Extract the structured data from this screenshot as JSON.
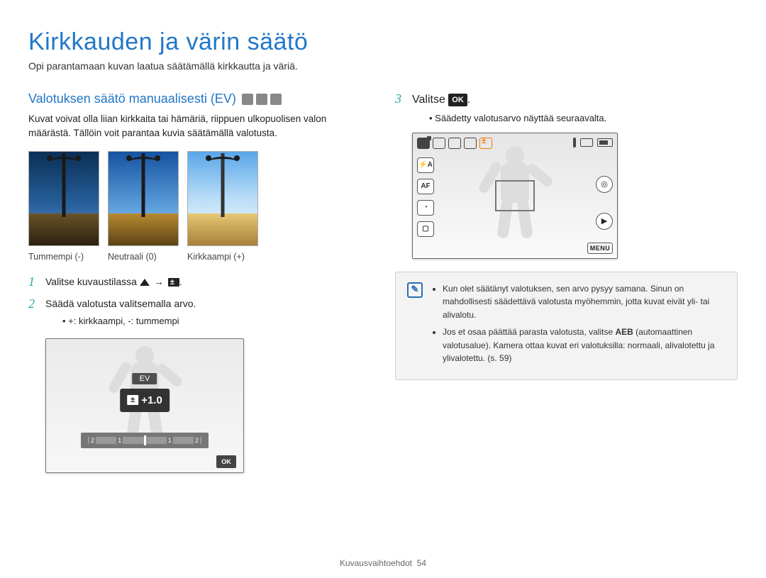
{
  "page": {
    "title": "Kirkkauden ja värin säätö",
    "subtitle": "Opi parantamaan kuvan laatua säätämällä kirkkautta ja väriä."
  },
  "left": {
    "heading": "Valotuksen säätö manuaalisesti (EV)",
    "intro": "Kuvat voivat olla liian kirkkaita tai hämäriä, riippuen ulkopuolisen valon määrästä. Tällöin voit parantaa kuvia säätämällä valotusta.",
    "thumbs": {
      "dark": "Tummempi (-)",
      "neutral": "Neutraali (0)",
      "bright": "Kirkkaampi (+)"
    },
    "step1_num": "1",
    "step1_text_a": "Valitse kuvaustilassa ",
    "step1_text_b": ".",
    "step1_arrow": "→",
    "step2_num": "2",
    "step2_text": "Säädä valotusta valitsemalla arvo.",
    "step2_sub": "+: kirkkaampi, -: tummempi",
    "lcd": {
      "ev_label": "EV",
      "ev_value": "+1.0",
      "scale": {
        "l2": "2",
        "l1": "1",
        "c": "1",
        "r1": "2"
      },
      "ok": "OK"
    }
  },
  "right": {
    "step3_num": "3",
    "step3_text_a": "Valitse ",
    "step3_text_b": ".",
    "step3_ok": "OK",
    "step3_sub": "Säädetty valotusarvo näyttää seuraavalta.",
    "lcd2": {
      "left_icons": {
        "flash": "⚡A",
        "af": "AF",
        "timer": "◔",
        "disp": "▢"
      },
      "right_icons": {
        "mode": "◎",
        "play": "▶"
      },
      "menu": "MENU"
    },
    "note": {
      "item1": "Kun olet säätänyt valotuksen, sen arvo pysyy samana. Sinun on mahdollisesti säädettävä valotusta myöhemmin, jotta kuvat eivät yli- tai alivalotu.",
      "item2_a": "Jos et osaa päättää parasta valotusta, valitse ",
      "item2_bold": "AEB",
      "item2_b": " (automaattinen valotusalue). Kamera ottaa kuvat eri valotuksilla: normaali, alivalotettu ja ylivalotettu. (s. 59)"
    }
  },
  "footer": {
    "section": "Kuvausvaihtoehdot",
    "page_num": "54"
  }
}
